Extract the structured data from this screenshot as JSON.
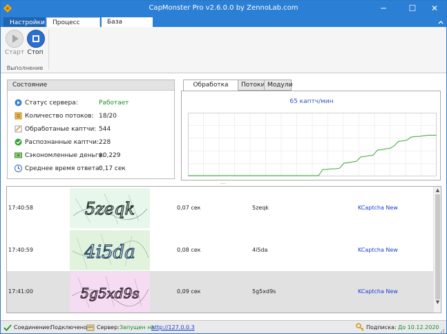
{
  "window": {
    "title": "CapMonster Pro v2.6.0.0 by ZennoLab.com",
    "minimize_glyph": "─",
    "maximize_glyph": "☐",
    "close_glyph": "✕"
  },
  "ribbon_tabs": [
    "Настройки",
    "Процесс работы",
    "База модулей"
  ],
  "ribbon": {
    "start_label": "Старт",
    "stop_label": "Стоп",
    "group_label": "Выполнение"
  },
  "status": {
    "header": "Состояние",
    "rows": [
      {
        "icon": "server-status-icon",
        "label": "Статус сервера:",
        "value": "Работает",
        "value_color": "#1a8a2a"
      },
      {
        "icon": "threads-icon",
        "label": "Количество потоков:",
        "value": "18/20"
      },
      {
        "icon": "processed-captcha-icon",
        "label": "Обработаные каптчи:",
        "value": "544"
      },
      {
        "icon": "recognized-check-icon",
        "label": "Распознанные каптчи:",
        "value": "228"
      },
      {
        "icon": "money-icon",
        "label": "Сэкономленные деньги:",
        "value": "$0,229"
      },
      {
        "icon": "clock-icon",
        "label": "Среднее время ответа:",
        "value": "0,17 сек"
      }
    ]
  },
  "chart_tabs": [
    "Обработка каптч",
    "Потоки",
    "Модули"
  ],
  "chart_data": {
    "type": "line",
    "title": "65 каптч/мин",
    "xlabel": "",
    "ylabel": "",
    "grid": true,
    "series_color": "#3aa63a",
    "x": [
      0,
      1,
      2,
      3,
      4,
      5,
      6,
      7,
      8,
      9,
      10,
      11,
      12,
      13,
      14,
      15,
      16,
      17,
      18,
      19,
      20,
      21,
      22,
      23,
      24,
      25,
      26,
      27,
      28,
      29,
      30,
      31,
      32,
      33,
      34,
      35,
      36,
      37,
      38,
      39,
      40,
      41,
      42,
      43,
      44,
      45,
      46,
      47,
      48,
      49,
      50,
      51,
      52,
      53,
      54,
      55,
      56,
      57,
      58,
      59
    ],
    "values": [
      0,
      0,
      0,
      0,
      0,
      0,
      0,
      0,
      0,
      0,
      0,
      0,
      0,
      0,
      0,
      0,
      0,
      0,
      0,
      0,
      0,
      0,
      0,
      0,
      0,
      0,
      0,
      0,
      0,
      0,
      0,
      0,
      10,
      10,
      11,
      11,
      12,
      20,
      21,
      22,
      23,
      30,
      31,
      32,
      33,
      41,
      42,
      43,
      44,
      48,
      55,
      56,
      57,
      62,
      63,
      63,
      64,
      65,
      65,
      65
    ],
    "ylim": [
      0,
      100
    ]
  },
  "splitter_glyph": "⋯",
  "captchas": [
    {
      "time": "17:40:58",
      "image_text": "5zeqk",
      "duration": "0,07 сек",
      "answer": "5zeqk",
      "module": "KCaptcha New",
      "bg": "#e8f7ec",
      "ink": "#2a3a34"
    },
    {
      "time": "17:40:59",
      "image_text": "4i5da",
      "duration": "0,08 сек",
      "answer": "4i5da",
      "module": "KCaptcha New",
      "bg": "#e2f3dd",
      "ink": "#2a4a6a"
    },
    {
      "time": "17:41:00",
      "image_text": "5g5xd9s",
      "duration": "0,09 сек",
      "answer": "5g5xd9s",
      "module": "KCaptcha New",
      "bg": "#f6dcf2",
      "ink": "#3a2a3a"
    }
  ],
  "scroll_up_glyph": "▲",
  "scroll_down_glyph": "▼",
  "statusbar": {
    "connection_label": "Соединение:",
    "connection_value": "Подключено",
    "server_label": "Сервер:",
    "server_running": "Запущен на",
    "server_url": "http://127.0.0.3",
    "subscription_label": "Подписка:",
    "subscription_value": "До 10.12.2020"
  },
  "colors": {
    "accent": "#2b7fd4",
    "ok": "#1a8a2a",
    "link": "#1a3fd4"
  }
}
